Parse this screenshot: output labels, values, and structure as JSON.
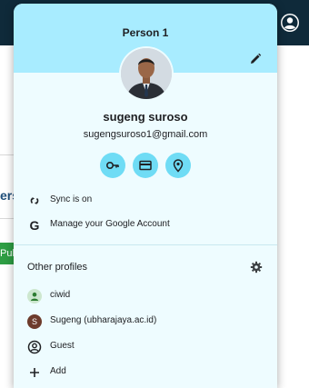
{
  "background": {
    "fragment_text_1": "ers",
    "fragment_text_2": "Pub"
  },
  "profile_menu": {
    "header_title": "Person 1",
    "user": {
      "name": "sugeng suroso",
      "email": "sugengsuroso1@gmail.com"
    },
    "quick_actions": [
      {
        "icon": "key-icon"
      },
      {
        "icon": "credit-card-icon"
      },
      {
        "icon": "location-pin-icon"
      }
    ],
    "menu": {
      "sync_label": "Sync is on",
      "manage_account_label": "Manage your Google Account"
    },
    "other_profiles": {
      "title": "Other profiles",
      "profiles": [
        {
          "label": "ciwid",
          "avatar_color": "#cde7cf"
        },
        {
          "label": "Sugeng (ubharajaya.ac.id)",
          "avatar_letter": "S",
          "avatar_color": "#6d3b2c"
        },
        {
          "label": "Guest"
        },
        {
          "label": "Add"
        }
      ]
    }
  },
  "colors": {
    "header_bg": "#a8ecff",
    "popup_bg": "#eefcff",
    "accent_button": "#6fdcf5",
    "topbar": "#0f2a3a"
  }
}
